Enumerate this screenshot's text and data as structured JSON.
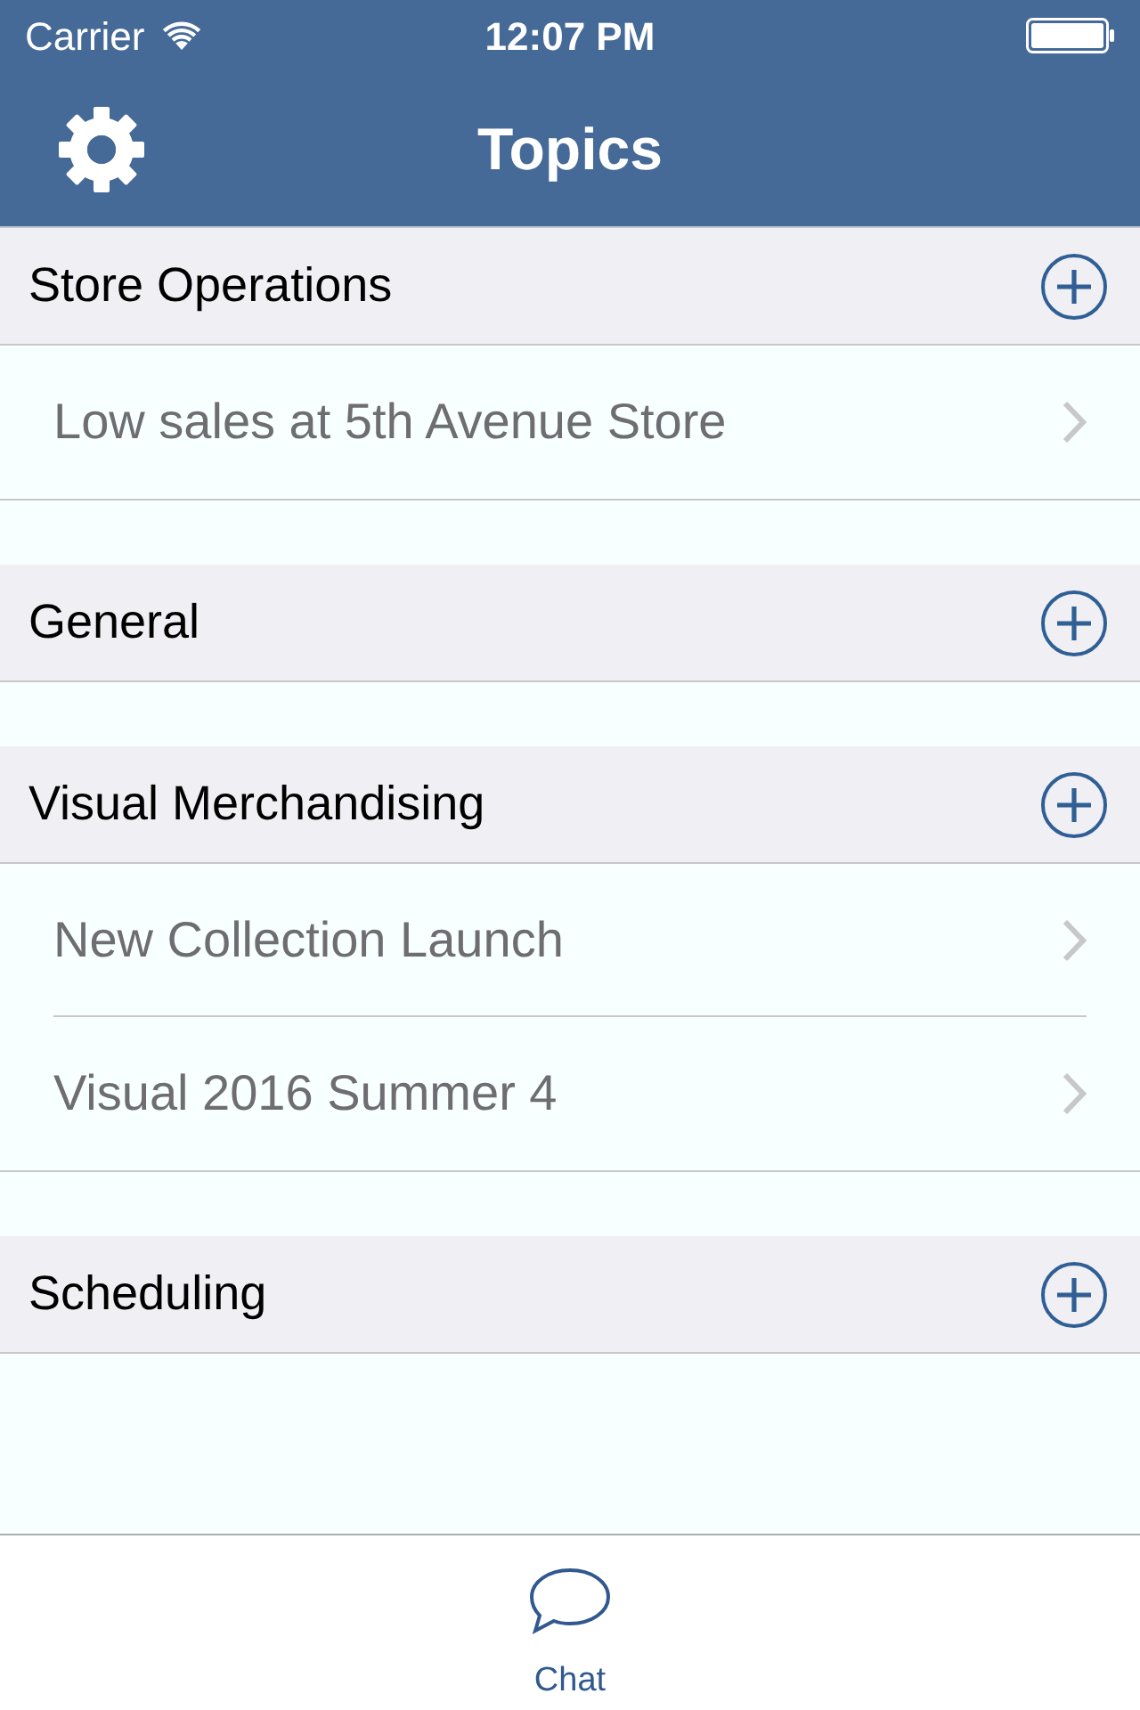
{
  "status_bar": {
    "carrier": "Carrier",
    "time": "12:07 PM"
  },
  "nav_bar": {
    "title": "Topics"
  },
  "sections": [
    {
      "title": "Store Operations",
      "topics": [
        {
          "title": "Low sales at 5th Avenue Store"
        }
      ]
    },
    {
      "title": "General"
    },
    {
      "title": "Visual Merchandising",
      "topics": [
        {
          "title": "New Collection Launch"
        },
        {
          "title": "Visual 2016 Summer 4"
        }
      ]
    },
    {
      "title": "Scheduling"
    }
  ],
  "tab_bar": {
    "items": [
      {
        "label": "Chat",
        "selected": true
      }
    ]
  }
}
